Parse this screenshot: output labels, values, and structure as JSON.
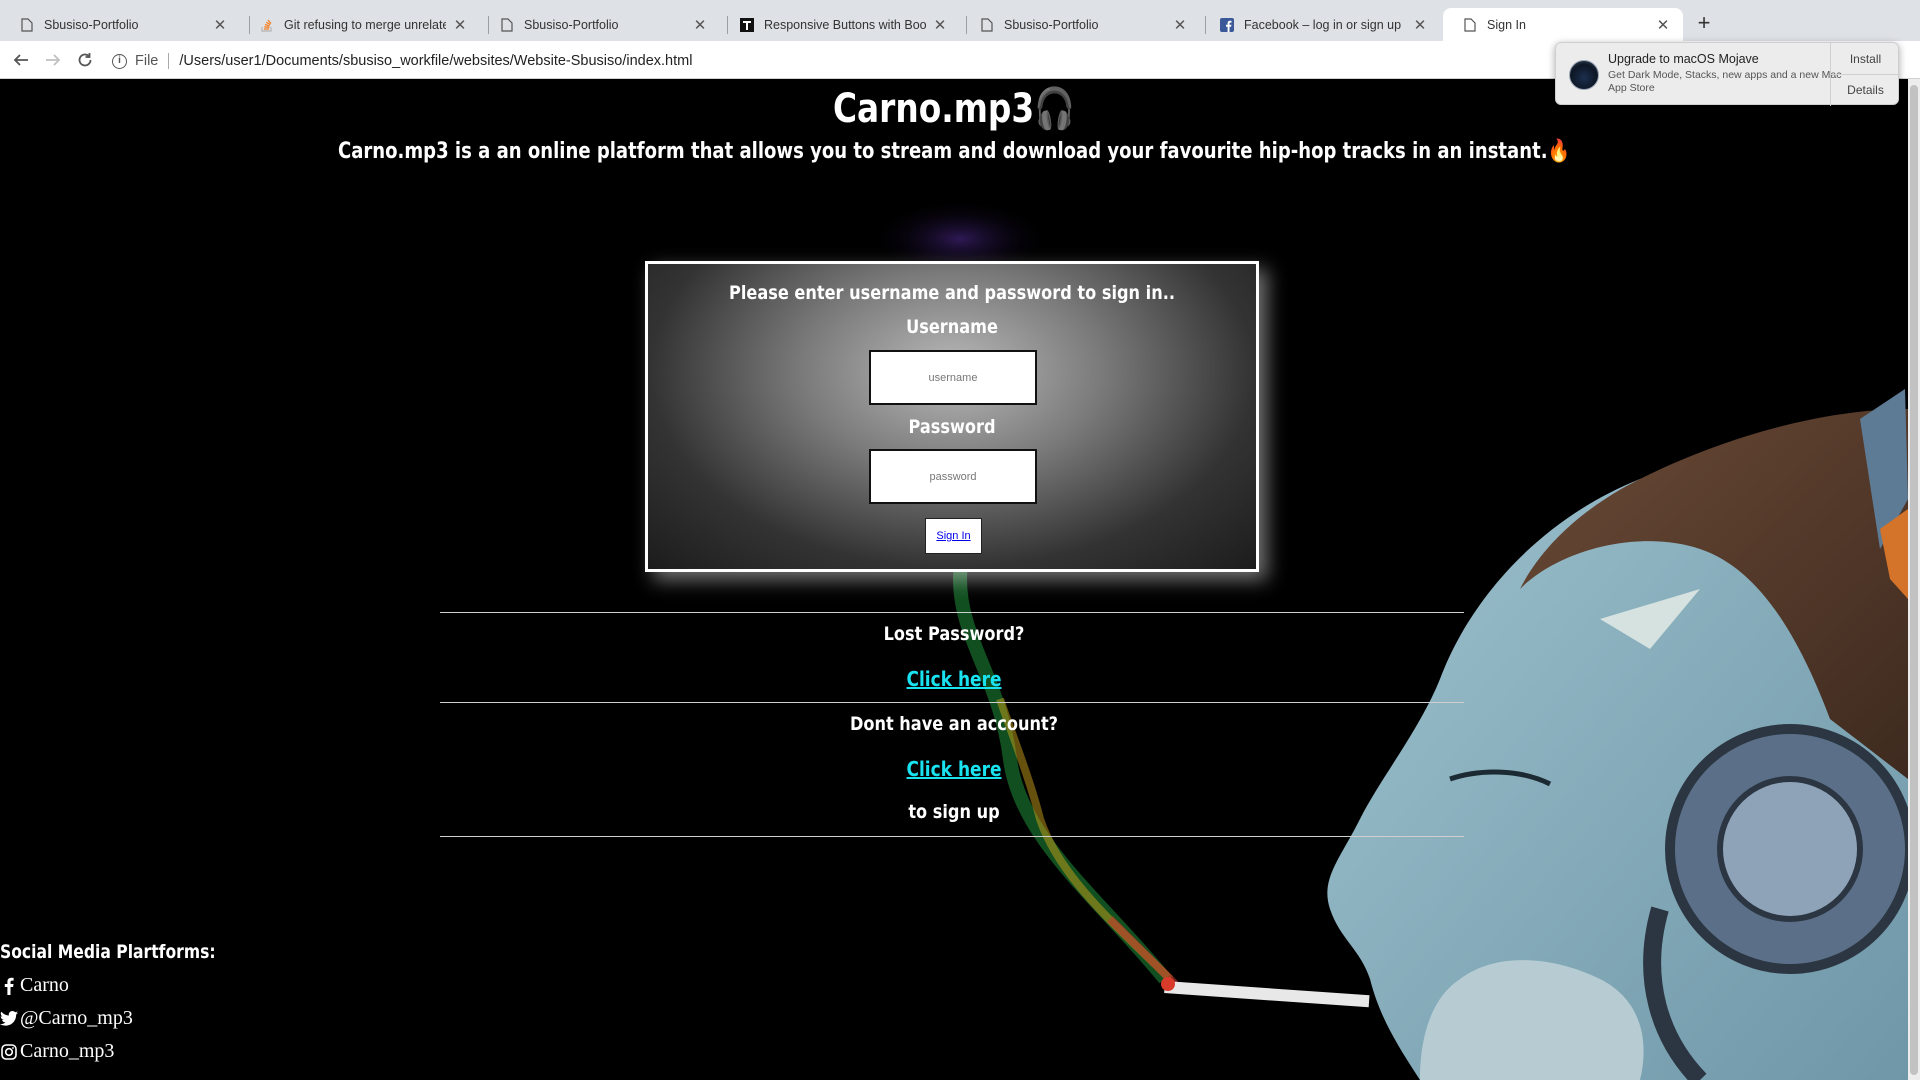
{
  "browser": {
    "tabs": [
      {
        "title": "Sbusiso-Portfolio",
        "icon": "document-icon",
        "active": false
      },
      {
        "title": "Git refusing to merge unrelated",
        "icon": "stackoverflow-icon",
        "active": false
      },
      {
        "title": "Sbusiso-Portfolio",
        "icon": "document-icon",
        "active": false
      },
      {
        "title": "Responsive Buttons with Boots",
        "icon": "tutorial-icon",
        "active": false
      },
      {
        "title": "Sbusiso-Portfolio",
        "icon": "document-icon",
        "active": false
      },
      {
        "title": "Facebook – log in or sign up",
        "icon": "facebook-icon",
        "active": false
      },
      {
        "title": "Sign In",
        "icon": "document-icon",
        "active": true
      }
    ],
    "new_tab_label": "+",
    "address": {
      "scheme": "File",
      "path": "/Users/user1/Documents/sbusiso_workfile/websites/Website-Sbusiso/index.html"
    }
  },
  "notification": {
    "title": "Upgrade to macOS Mojave",
    "body": "Get Dark Mode, Stacks, new apps and a new Mac App Store",
    "install_label": "Install",
    "details_label": "Details"
  },
  "page": {
    "title": "Carno.mp3🎧",
    "tagline": "Carno.mp3 is a an online platform that allows you to stream and download your favourite hip-hop tracks in an instant.🔥",
    "signin": {
      "heading": "Please enter username and password to sign in..",
      "username_label": "Username",
      "username_placeholder": "username",
      "password_label": "Password",
      "password_placeholder": "password",
      "button_label": "Sign In"
    },
    "lost_password": "Lost Password?",
    "lost_password_link": "Click here",
    "no_account": "Dont have an account?",
    "signup_link": "Click here",
    "signup_suffix": "to sign up",
    "social": {
      "heading": "Social Media Plartforms:",
      "items": [
        {
          "icon": "facebook-icon",
          "label": "Carno"
        },
        {
          "icon": "twitter-icon",
          "label": "@Carno_mp3"
        },
        {
          "icon": "instagram-icon",
          "label": "Carno_mp3"
        }
      ]
    }
  },
  "colors": {
    "link": "#19e3f0",
    "page_bg": "#000000",
    "tabbar_bg": "#dee1e6"
  }
}
